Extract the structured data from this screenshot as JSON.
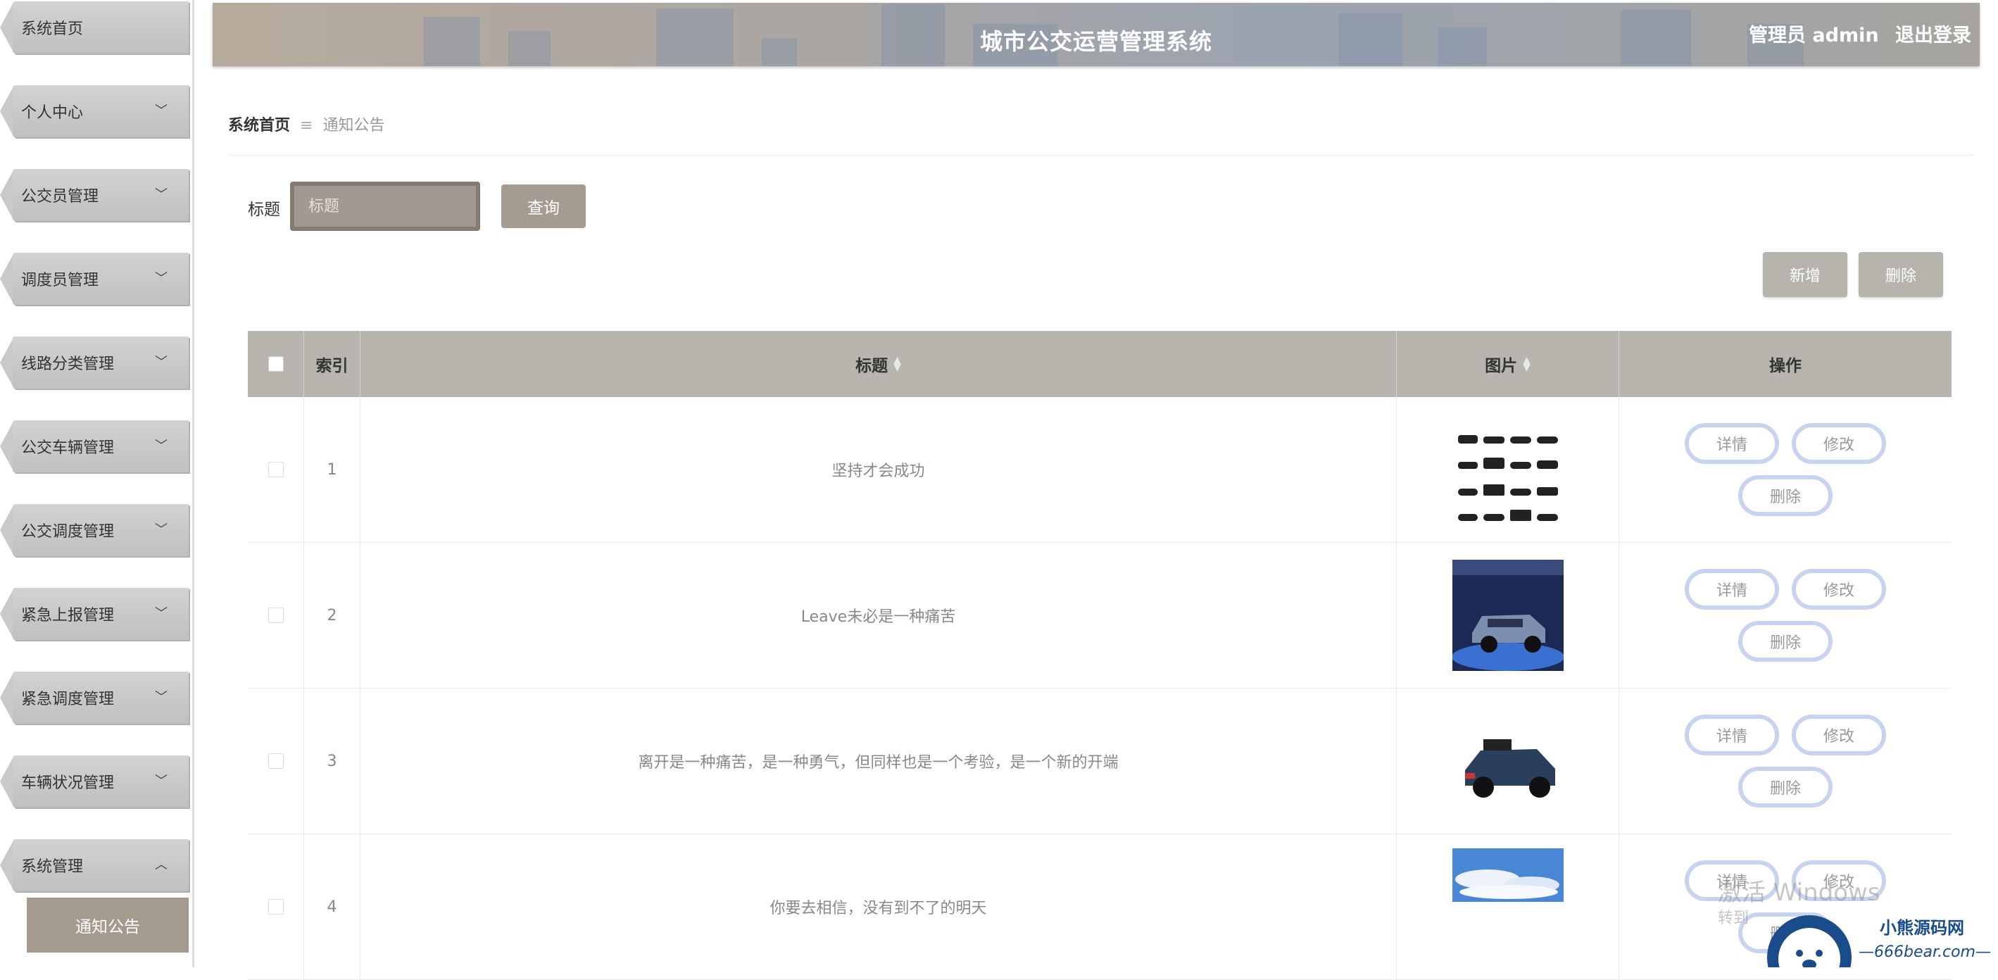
{
  "sidebar": {
    "items": [
      {
        "label": "系统首页",
        "expanded": null
      },
      {
        "label": "个人中心",
        "expanded": false
      },
      {
        "label": "公交员管理",
        "expanded": false
      },
      {
        "label": "调度员管理",
        "expanded": false
      },
      {
        "label": "线路分类管理",
        "expanded": false
      },
      {
        "label": "公交车辆管理",
        "expanded": false
      },
      {
        "label": "公交调度管理",
        "expanded": false
      },
      {
        "label": "紧急上报管理",
        "expanded": false
      },
      {
        "label": "紧急调度管理",
        "expanded": false
      },
      {
        "label": "车辆状况管理",
        "expanded": false
      },
      {
        "label": "系统管理",
        "expanded": true
      }
    ],
    "sub_item": "通知公告",
    "chevron_down": "﹀",
    "chevron_up": "︿"
  },
  "header": {
    "title": "城市公交运营管理系统",
    "user": "管理员 admin",
    "logout": "退出登录"
  },
  "breadcrumb": {
    "home": "系统首页",
    "separator": "≡",
    "current": "通知公告"
  },
  "search": {
    "label": "标题",
    "placeholder": "标题",
    "button": "查询"
  },
  "actions": {
    "add": "新增",
    "delete": "删除"
  },
  "table": {
    "headers": {
      "index": "索引",
      "title": "标题",
      "image": "图片",
      "operation": "操作"
    },
    "op_labels": {
      "detail": "详情",
      "edit": "修改",
      "delete": "删除"
    },
    "rows": [
      {
        "index": "1",
        "title": "坚持才会成功",
        "image": "car-silhouettes"
      },
      {
        "index": "2",
        "title": "Leave未必是一种痛苦",
        "image": "suv-showroom"
      },
      {
        "index": "3",
        "title": "离开是一种痛苦，是一种勇气，但同样也是一个考验，是一个新的开端",
        "image": "toy-car"
      },
      {
        "index": "4",
        "title": "你要去相信，没有到不了的明天",
        "image": "sky-clouds"
      }
    ]
  },
  "watermark": {
    "activate": "激活 Windows",
    "goto": "转到",
    "site_name": "小熊源码网",
    "site_url": "—666bear.com—"
  },
  "colors": {
    "accent": "#a59a8e",
    "header_bg": "#aaa6a3",
    "table_header": "#b7b5ae",
    "op_border": "#c8d3ef"
  }
}
